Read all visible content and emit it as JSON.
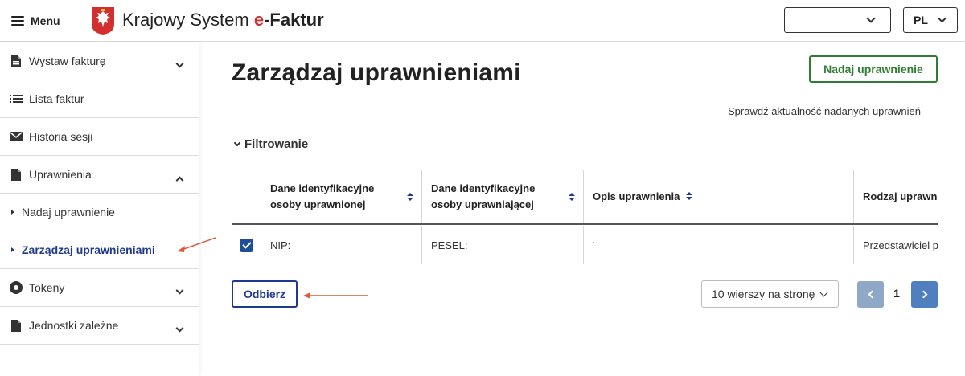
{
  "header": {
    "menu_label": "Menu",
    "brand_prefix": "Krajowy System ",
    "brand_e": "e",
    "brand_suffix": "-Faktur",
    "top_select_value": "",
    "language": "PL"
  },
  "sidebar": {
    "items": [
      {
        "label": "Wystaw fakturę",
        "icon": "document-icon",
        "expandable": true
      },
      {
        "label": "Lista faktur",
        "icon": "list-icon",
        "expandable": false
      },
      {
        "label": "Historia sesji",
        "icon": "envelope-icon",
        "expandable": false
      },
      {
        "label": "Uprawnienia",
        "icon": "document-icon",
        "expandable": true,
        "expanded": true
      },
      {
        "label": "Nadaj uprawnienie",
        "sub": true
      },
      {
        "label": "Zarządzaj uprawnieniami",
        "sub": true,
        "active": true
      },
      {
        "label": "Tokeny",
        "icon": "token-icon",
        "expandable": true
      },
      {
        "label": "Jednostki zależne",
        "icon": "document-icon",
        "expandable": true
      }
    ]
  },
  "main": {
    "title": "Zarządzaj uprawnieniami",
    "grant_button": "Nadaj uprawnienie",
    "check_text": "Sprawdź aktualność nadanych uprawnień",
    "filter_label": "Filtrowanie",
    "table": {
      "columns": [
        {
          "line1": "Dane identyfikacyjne",
          "line2": "osoby uprawnionej"
        },
        {
          "line1": "Dane identyfikacyjne",
          "line2": "osoby uprawniającej"
        },
        {
          "line1": "Opis uprawnienia",
          "line2": ""
        },
        {
          "line1": "Rodzaj uprawn",
          "line2": ""
        }
      ],
      "rows": [
        {
          "checked": true,
          "cells": [
            "NIP:",
            "PESEL:",
            "·",
            "Przedstawiciel p"
          ]
        }
      ]
    },
    "revoke_button": "Odbierz",
    "rows_per_page": "10 wierszy na stronę",
    "current_page": "1"
  },
  "colors": {
    "accent_blue": "#1f3a8a",
    "accent_green": "#2e7d32",
    "annotation_red": "#e05a3a"
  }
}
